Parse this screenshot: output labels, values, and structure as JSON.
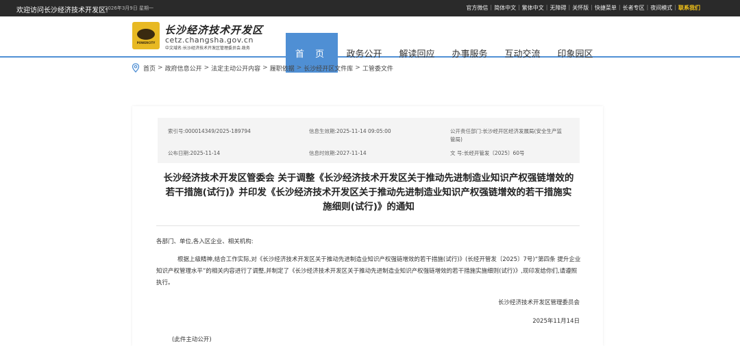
{
  "topbar": {
    "welcome": "欢迎访问长沙经济技术开发区!",
    "date": "2026年3月9日 星期一",
    "links": [
      "官方微信",
      "简体中文",
      "繁体中文",
      "无障碍",
      "关怀版",
      "快捷菜单",
      "长者专区",
      "夜间模式",
      "联系我们"
    ]
  },
  "header": {
    "brand_name": "长沙经济技术开发区",
    "domain": "cetz.changsha.gov.cn",
    "sub": "中文域名:长沙经济技术开发区管理委员会.政务",
    "logo_text": "POWERCITY"
  },
  "nav": {
    "items": [
      "首 页",
      "政务公开",
      "解读回应",
      "办事服务",
      "互动交流",
      "印象园区"
    ]
  },
  "breadcrumb": [
    "首页",
    "政府信息公开",
    "法定主动公开内容",
    "履职依据",
    "长沙经开区文件库",
    "工管委文件"
  ],
  "meta": {
    "index_label": "索引号:",
    "index_value": "000014349/2025-189794",
    "effective_label": "信息生效期:",
    "effective_value": "2025-11-14 09:05:00",
    "dept_label": "公开责任部门:",
    "dept_value_1": "长沙经开区经济发展局(安全生产监",
    "dept_value_2": "管局)",
    "publish_label": "公布日期:",
    "publish_value": "2025-11-14",
    "expire_label": "信息时效期:",
    "expire_value": "2027-11-14",
    "docno_label": "文 号:",
    "docno_value": "长经开管发〔2025〕60号"
  },
  "article": {
    "title_1": "长沙经济技术开发区管委会 关于调整《长沙经济技术开发区关于推动先进制造业知识产权强链增效的",
    "title_2": "若干措施(试行)》并印发《长沙经济技术开发区关于推动先进制造业知识产权强链增效的若干措施实",
    "title_3": "施细则(试行)》的通知",
    "salutation": "各部门、单位,各入区企业、相关机构:",
    "paragraph": "根据上级精神,结合工作实际,对《长沙经济技术开发区关于推动先进制造业知识产权强链增效的若干措施(试行)》(长经开管发〔2025〕7号)“第四条 提升企业知识产权管理水平”的相关内容进行了调整,并制定了《长沙经济技术开发区关于推动先进制造业知识产权强链增效的若干措施实施细则(试行)》,现印发给你们,请遵照执行。",
    "signature": "长沙经济技术开发区管理委员会",
    "sign_date": "2025年11月14日",
    "note": "(此件主动公开)"
  },
  "colors": {
    "nav_active": "#4f8fd4",
    "topbar": "#2a2a2a",
    "highlight": "#f5c518"
  }
}
